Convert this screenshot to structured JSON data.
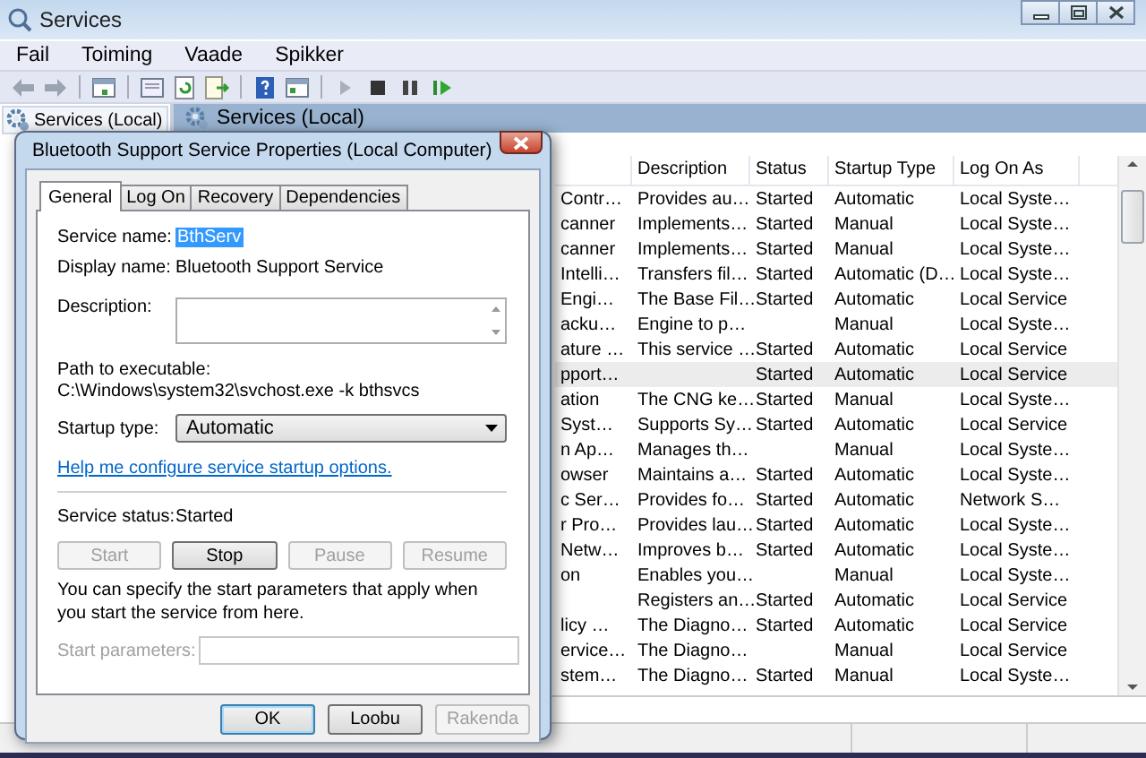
{
  "window": {
    "title": "Services",
    "menu": [
      "Fail",
      "Toiming",
      "Vaade",
      "Spikker"
    ]
  },
  "tree": {
    "items": [
      {
        "label": "Services (Local)",
        "selected": true
      }
    ]
  },
  "pane": {
    "title": "Services (Local)"
  },
  "table": {
    "columns": [
      "Description",
      "Status",
      "Startup Type",
      "Log On As"
    ],
    "rows": [
      {
        "column_1": "Contr…",
        "description": "Provides au…",
        "status": "Started",
        "startup_type": "Automatic",
        "log_on_as": "Local Syste…",
        "selected": false
      },
      {
        "column_1": "canner",
        "description": "Implements…",
        "status": "Started",
        "startup_type": "Manual",
        "log_on_as": "Local Syste…",
        "selected": false
      },
      {
        "column_1": "canner",
        "description": "Implements…",
        "status": "Started",
        "startup_type": "Manual",
        "log_on_as": "Local Syste…",
        "selected": false
      },
      {
        "column_1": "Intelli…",
        "description": "Transfers fil…",
        "status": "Started",
        "startup_type": "Automatic (D…",
        "log_on_as": "Local Syste…",
        "selected": false
      },
      {
        "column_1": "Engi…",
        "description": "The Base Fil…",
        "status": "Started",
        "startup_type": "Automatic",
        "log_on_as": "Local Service",
        "selected": false
      },
      {
        "column_1": "acku…",
        "description": "Engine to p…",
        "startup_type": "Manual",
        "log_on_as": "Local Syste…",
        "selected": false
      },
      {
        "column_1": "ature …",
        "description": "This service …",
        "status": "Started",
        "startup_type": "Automatic",
        "log_on_as": "Local Service",
        "selected": false
      },
      {
        "column_1": "pport…",
        "status": "Started",
        "startup_type": "Automatic",
        "log_on_as": "Local Service",
        "selected": true
      },
      {
        "column_1": "ation",
        "description": "The CNG ke…",
        "status": "Started",
        "startup_type": "Manual",
        "log_on_as": "Local Syste…",
        "selected": false
      },
      {
        "column_1": "Syst…",
        "description": "Supports Sy…",
        "status": "Started",
        "startup_type": "Automatic",
        "log_on_as": "Local Service",
        "selected": false
      },
      {
        "column_1": "n Ap…",
        "description": "Manages th…",
        "startup_type": "Manual",
        "log_on_as": "Local Syste…",
        "selected": false
      },
      {
        "column_1": "owser",
        "description": "Maintains a…",
        "status": "Started",
        "startup_type": "Automatic",
        "log_on_as": "Local Syste…",
        "selected": false
      },
      {
        "column_1": "c Ser…",
        "description": "Provides fo…",
        "status": "Started",
        "startup_type": "Automatic",
        "log_on_as": "Network S…",
        "selected": false
      },
      {
        "column_1": "r Pro…",
        "description": "Provides lau…",
        "status": "Started",
        "startup_type": "Automatic",
        "log_on_as": "Local Syste…",
        "selected": false
      },
      {
        "column_1": "Netw…",
        "description": "Improves b…",
        "status": "Started",
        "startup_type": "Automatic",
        "log_on_as": "Local Syste…",
        "selected": false
      },
      {
        "column_1": "on",
        "description": "Enables you…",
        "startup_type": "Manual",
        "log_on_as": "Local Syste…",
        "selected": false
      },
      {
        "description": "Registers an…",
        "status": "Started",
        "startup_type": "Automatic",
        "log_on_as": "Local Service",
        "selected": false
      },
      {
        "column_1": "licy …",
        "description": "The Diagno…",
        "status": "Started",
        "startup_type": "Automatic",
        "log_on_as": "Local Service",
        "selected": false
      },
      {
        "column_1": "ervice…",
        "description": "The Diagno…",
        "startup_type": "Manual",
        "log_on_as": "Local Service",
        "selected": false
      },
      {
        "column_1": "stem…",
        "description": "The Diagno…",
        "status": "Started",
        "startup_type": "Manual",
        "log_on_as": "Local Syste…",
        "selected": false
      }
    ]
  },
  "dialog": {
    "title": "Bluetooth Support Service Properties (Local Computer)",
    "tabs": [
      {
        "label": "General",
        "selected": true
      },
      {
        "label": "Log On",
        "selected": false
      },
      {
        "label": "Recovery",
        "selected": false
      },
      {
        "label": "Dependencies",
        "selected": false
      }
    ],
    "service_name": {
      "label": "Service name:",
      "value": "BthServ"
    },
    "display_name": {
      "label": "Display name:",
      "value": "Bluetooth Support Service"
    },
    "description": {
      "label": "Description:"
    },
    "path": {
      "label": "Path to executable:",
      "value": "C:\\Windows\\system32\\svchost.exe -k bthsvcs"
    },
    "startup_type": {
      "label": "Startup type:",
      "value": "Automatic"
    },
    "help_link": "Help me configure service startup options.",
    "service_status": {
      "label": "Service status:",
      "value": "Started"
    },
    "control_buttons": [
      {
        "label": "Start",
        "disabled": true
      },
      {
        "label": "Stop",
        "disabled": false
      },
      {
        "label": "Pause",
        "disabled": true
      },
      {
        "label": "Resume",
        "disabled": true
      }
    ],
    "note": "You can specify the start parameters that apply when you start the service from here.",
    "start_parameters": {
      "label": "Start parameters:",
      "disabled": true
    },
    "buttons": [
      {
        "label": "OK",
        "disabled": false,
        "default": true
      },
      {
        "label": "Loobu",
        "disabled": false,
        "default": false
      },
      {
        "label": "Rakenda",
        "disabled": true,
        "default": false
      }
    ]
  }
}
